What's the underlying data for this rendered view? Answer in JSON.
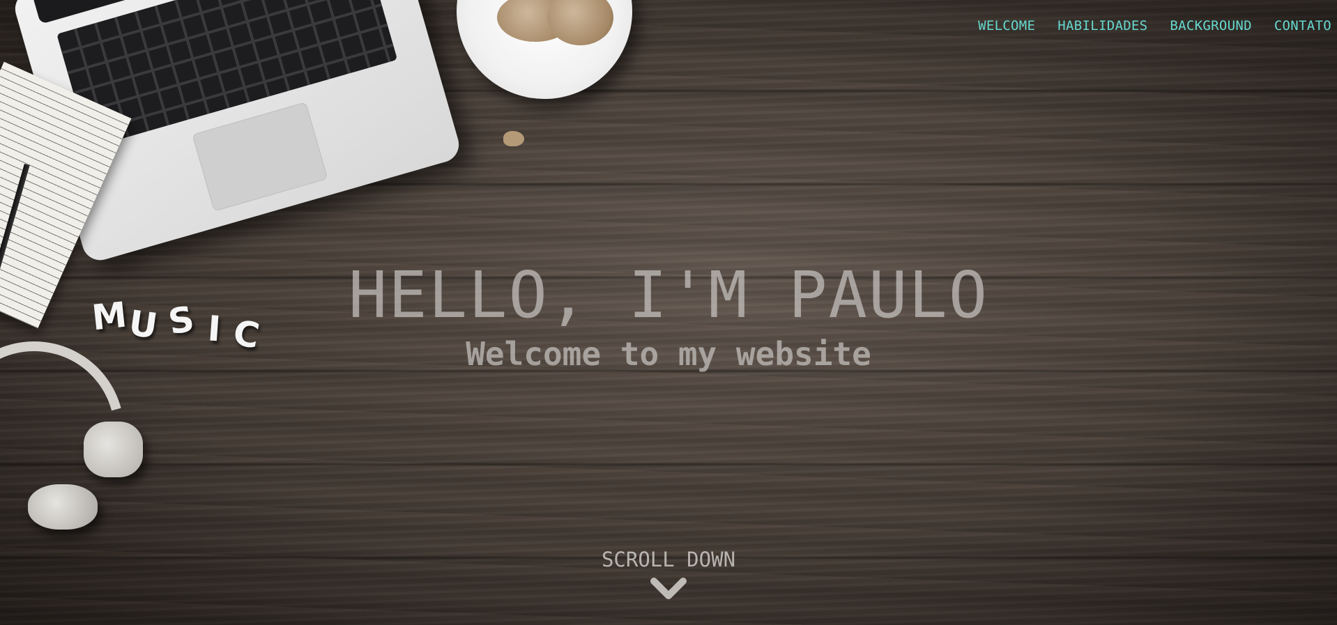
{
  "nav": {
    "items": [
      {
        "label": "WELCOME"
      },
      {
        "label": "HABILIDADES"
      },
      {
        "label": "BACKGROUND"
      },
      {
        "label": "CONTATO"
      }
    ]
  },
  "hero": {
    "title": "HELLO, I'M PAULO",
    "subtitle": "Welcome to my website"
  },
  "scroll": {
    "label": "SCROLL DOWN",
    "icon": "chevron-down-icon"
  },
  "decor": {
    "letters": [
      "M",
      "U",
      "S",
      "I",
      "C"
    ]
  },
  "colors": {
    "nav_accent": "#66d9cf",
    "hero_text": "#c8c4c0",
    "background": "#3c3530"
  }
}
